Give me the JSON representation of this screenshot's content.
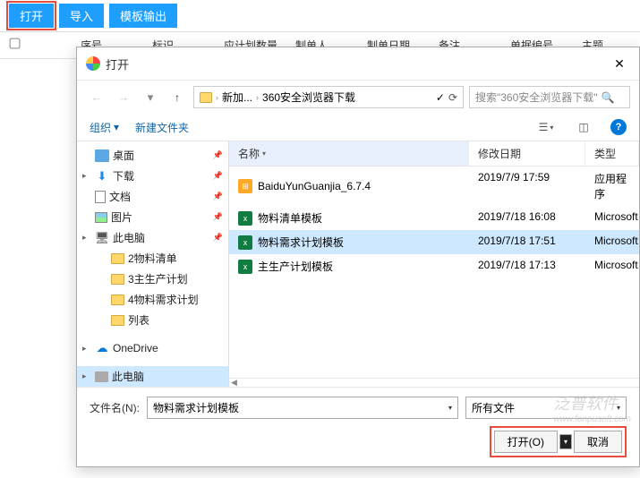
{
  "toolbar": {
    "open": "打开",
    "import": "导入",
    "template_output": "模板输出"
  },
  "bg_table": {
    "col_seq": "序号",
    "col_mark": "标识",
    "col_plan_qty": "应计划数量",
    "col_creator": "制单人",
    "col_date": "制单日期",
    "col_remark": "备注",
    "col_order_no": "单据编号",
    "col_title": "主题"
  },
  "dialog": {
    "title": "打开",
    "close": "✕",
    "nav_back": "←",
    "nav_forward": "→",
    "nav_recent_dd": "▾",
    "nav_up": "↑",
    "breadcrumb_item1": "新加...",
    "breadcrumb_item2": "360安全浏览器下载",
    "breadcrumb_sep": "›",
    "breadcrumb_dd": "✓",
    "search_placeholder": "搜索\"360安全浏览器下载\"",
    "organize": "组织",
    "organize_dd": "▾",
    "new_folder": "新建文件夹",
    "view_dd": "▾",
    "help": "?",
    "col_name": "名称",
    "col_date": "修改日期",
    "col_type": "类型",
    "filename_label": "文件名(N):",
    "filename_value": "物料需求计划模板",
    "filetype_value": "所有文件",
    "open_btn": "打开(O)",
    "open_split": "▾",
    "cancel_btn": "取消"
  },
  "tree": [
    {
      "label": "桌面",
      "icon": "desktop",
      "chev": "",
      "pin": true,
      "depth": 0
    },
    {
      "label": "下载",
      "icon": "download",
      "chev": "▸",
      "pin": true,
      "depth": 0
    },
    {
      "label": "文档",
      "icon": "doc",
      "chev": "",
      "pin": true,
      "depth": 0
    },
    {
      "label": "图片",
      "icon": "pic",
      "chev": "",
      "pin": true,
      "depth": 0
    },
    {
      "label": "此电脑",
      "icon": "pc",
      "chev": "▸",
      "pin": true,
      "depth": 0
    },
    {
      "label": "2物料清单",
      "icon": "folder",
      "chev": "",
      "depth": 1
    },
    {
      "label": "3主生产计划",
      "icon": "folder",
      "chev": "",
      "depth": 1
    },
    {
      "label": "4物料需求计划",
      "icon": "folder",
      "chev": "",
      "depth": 1
    },
    {
      "label": "列表",
      "icon": "folder",
      "chev": "",
      "depth": 1
    },
    {
      "label": "OneDrive",
      "icon": "cloud",
      "chev": "▸",
      "depth": 0,
      "gap_before": true
    },
    {
      "label": "此电脑",
      "icon": "pcgray",
      "chev": "▸",
      "depth": 0,
      "selected": true,
      "gap_before": true
    }
  ],
  "files": [
    {
      "name": "BaiduYunGuanjia_6.7.4",
      "date": "2019/7/9 17:59",
      "type": "应用程序",
      "icon": "app"
    },
    {
      "name": "物料清单模板",
      "date": "2019/7/18 16:08",
      "type": "Microsoft",
      "icon": "xls"
    },
    {
      "name": "物料需求计划模板",
      "date": "2019/7/18 17:51",
      "type": "Microsoft",
      "icon": "xls",
      "selected": true
    },
    {
      "name": "主生产计划模板",
      "date": "2019/7/18 17:13",
      "type": "Microsoft",
      "icon": "xls"
    }
  ],
  "watermark": {
    "brand": "泛普软件",
    "url": "www.fanpusoft.com"
  }
}
